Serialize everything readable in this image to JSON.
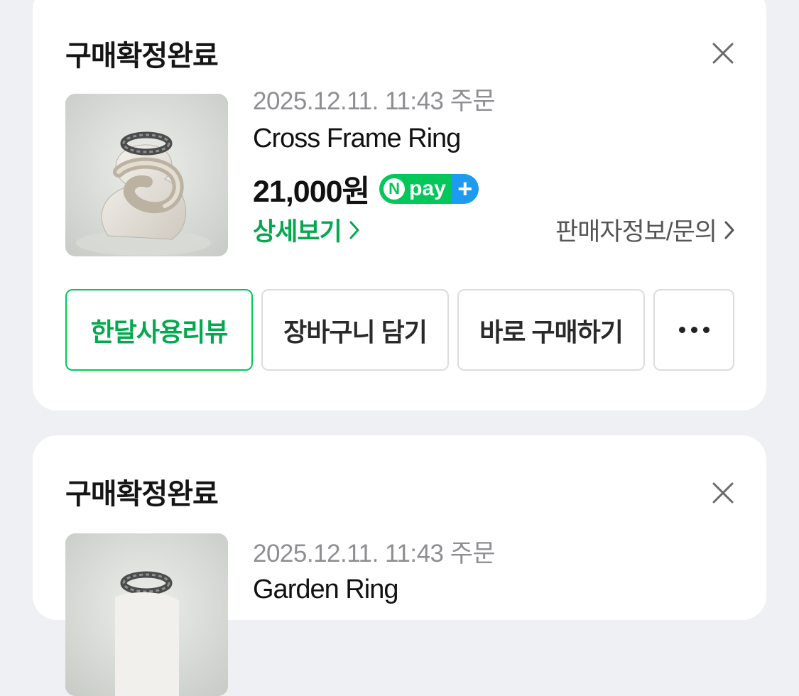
{
  "orders": [
    {
      "status": "구매확정완료",
      "date": "2025.12.11. 11:43 주문",
      "product_name": "Cross Frame Ring",
      "price": "21,000원",
      "npay": {
        "n": "N",
        "text": "pay",
        "plus": "+"
      },
      "detail_label": "상세보기",
      "seller_label": "판매자정보/문의",
      "buttons": {
        "review": "한달사용리뷰",
        "cart": "장바구니 담기",
        "buy_now": "바로 구매하기"
      }
    },
    {
      "status": "구매확정완료",
      "date": "2025.12.11. 11:43 주문",
      "product_name": "Garden Ring"
    }
  ],
  "icons": {
    "close": "close-icon",
    "chevron": "chevron-right-icon",
    "more": "more-dots-icon"
  },
  "colors": {
    "accent": "#03c75a",
    "npay_plus": "#1e9bf0",
    "background": "#eef0f3"
  }
}
